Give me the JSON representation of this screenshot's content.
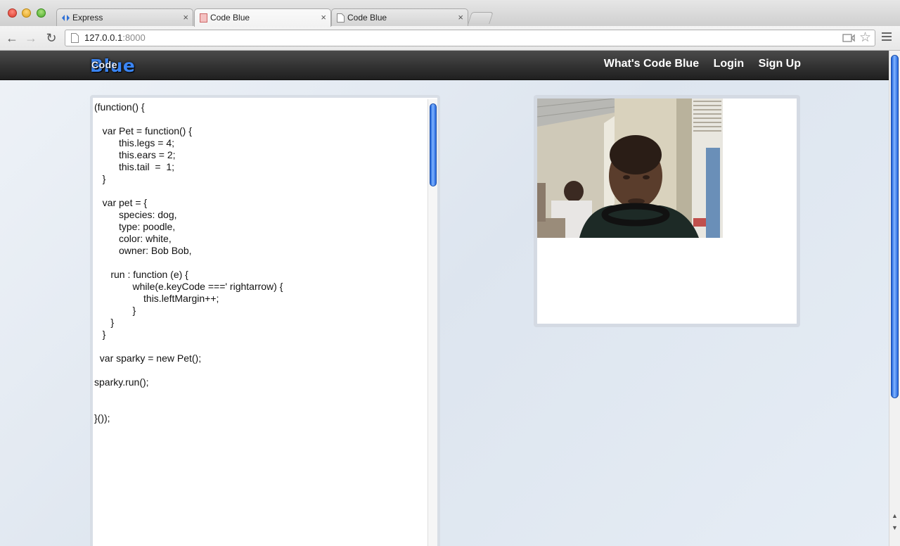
{
  "browser": {
    "tabs": [
      {
        "title": "Express",
        "icon": "express-icon"
      },
      {
        "title": "Code Blue",
        "icon": "page-icon",
        "active": true
      },
      {
        "title": "Code Blue",
        "icon": "document-icon"
      }
    ],
    "tab_close": "×",
    "address": {
      "host": "127.0.0.1",
      "port": ":8000"
    },
    "star": "☆"
  },
  "site": {
    "logo": {
      "part1": "Code",
      "part2": "Blue"
    },
    "nav": [
      {
        "label": "What's Code Blue"
      },
      {
        "label": "Login"
      },
      {
        "label": "Sign Up"
      }
    ],
    "colors": {
      "logo_blue": "#3b86f5",
      "scrollbar_blue": "#2566dd"
    }
  },
  "editor": {
    "lines": [
      "(function() {",
      "",
      "   var Pet = function() {",
      "         this.legs = 4;",
      "         this.ears = 2;",
      "         this.tail  =  1;",
      "   }",
      "",
      "   var pet = {",
      "         species: dog,",
      "         type: poodle,",
      "         color: white,",
      "         owner: Bob Bob,",
      "",
      "      run : function (e) {",
      "              while(e.keyCode ===' rightarrow) {",
      "                  this.leftMargin++;",
      "              }",
      "      }",
      "   }",
      "",
      "  var sparky = new Pet();",
      "",
      "sparky.run();",
      "",
      "",
      "}());"
    ]
  }
}
